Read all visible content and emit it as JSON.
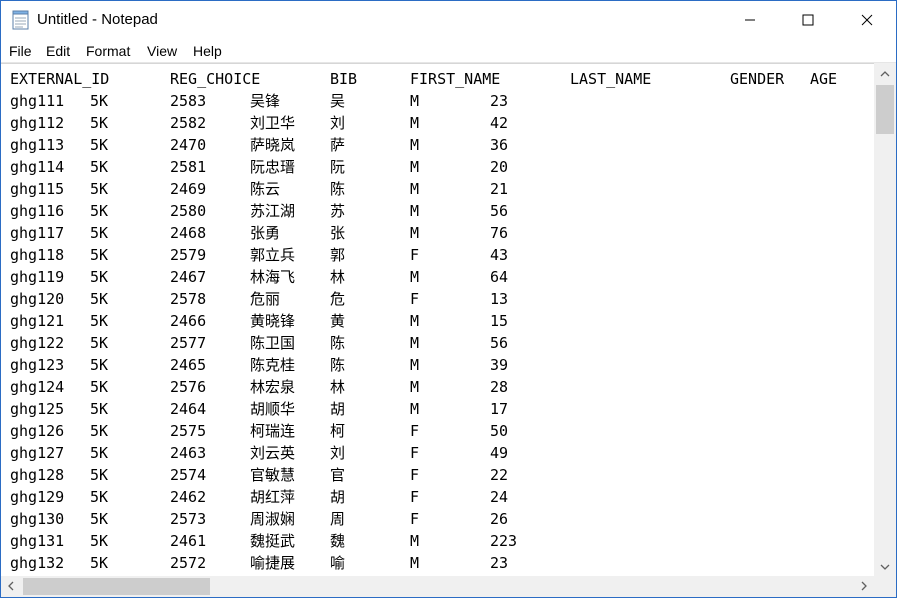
{
  "window": {
    "title": "Untitled - Notepad"
  },
  "menu": [
    "File",
    "Edit",
    "Format",
    "View",
    "Help"
  ],
  "header": [
    "EXTERNAL_ID",
    "REG_CHOICE",
    "BIB",
    "FIRST_NAME",
    "LAST_NAME",
    "GENDER",
    "AGE"
  ],
  "rows": [
    [
      "ghg111",
      "5K",
      "2583",
      "吴锋",
      "吴",
      "M",
      "23"
    ],
    [
      "ghg112",
      "5K",
      "2582",
      "刘卫华",
      "刘",
      "M",
      "42"
    ],
    [
      "ghg113",
      "5K",
      "2470",
      "萨晓岚",
      "萨",
      "M",
      "36"
    ],
    [
      "ghg114",
      "5K",
      "2581",
      "阮忠瑨",
      "阮",
      "M",
      "20"
    ],
    [
      "ghg115",
      "5K",
      "2469",
      "陈云",
      "陈",
      "M",
      "21"
    ],
    [
      "ghg116",
      "5K",
      "2580",
      "苏江湖",
      "苏",
      "M",
      "56"
    ],
    [
      "ghg117",
      "5K",
      "2468",
      "张勇",
      "张",
      "M",
      "76"
    ],
    [
      "ghg118",
      "5K",
      "2579",
      "郭立兵",
      "郭",
      "F",
      "43"
    ],
    [
      "ghg119",
      "5K",
      "2467",
      "林海飞",
      "林",
      "M",
      "64"
    ],
    [
      "ghg120",
      "5K",
      "2578",
      "危丽",
      "危",
      "F",
      "13"
    ],
    [
      "ghg121",
      "5K",
      "2466",
      "黄晓锋",
      "黄",
      "M",
      "15"
    ],
    [
      "ghg122",
      "5K",
      "2577",
      "陈卫国",
      "陈",
      "M",
      "56"
    ],
    [
      "ghg123",
      "5K",
      "2465",
      "陈克桂",
      "陈",
      "M",
      "39"
    ],
    [
      "ghg124",
      "5K",
      "2576",
      "林宏泉",
      "林",
      "M",
      "28"
    ],
    [
      "ghg125",
      "5K",
      "2464",
      "胡顺华",
      "胡",
      "M",
      "17"
    ],
    [
      "ghg126",
      "5K",
      "2575",
      "柯瑞连",
      "柯",
      "F",
      "50"
    ],
    [
      "ghg127",
      "5K",
      "2463",
      "刘云英",
      "刘",
      "F",
      "49"
    ],
    [
      "ghg128",
      "5K",
      "2574",
      "官敏慧",
      "官",
      "F",
      "22"
    ],
    [
      "ghg129",
      "5K",
      "2462",
      "胡红萍",
      "胡",
      "F",
      "24"
    ],
    [
      "ghg130",
      "5K",
      "2573",
      "周淑娴",
      "周",
      "F",
      "26"
    ],
    [
      "ghg131",
      "5K",
      "2461",
      "魏挺武",
      "魏",
      "M",
      "223"
    ],
    [
      "ghg132",
      "5K",
      "2572",
      "喻捷展",
      "喻",
      "M",
      "23"
    ]
  ],
  "scroll": {
    "vertical_position": 0.0,
    "horizontal_position": 0.0
  },
  "colors": {
    "window_border": "#2b6cc4",
    "scrollbar_track": "#f0f0f0",
    "scrollbar_thumb": "#cdcdcd"
  },
  "icons": [
    "notepad-app-icon",
    "minimize-icon",
    "maximize-icon",
    "close-icon",
    "scroll-up-icon",
    "scroll-down-icon",
    "scroll-left-icon",
    "scroll-right-icon"
  ]
}
